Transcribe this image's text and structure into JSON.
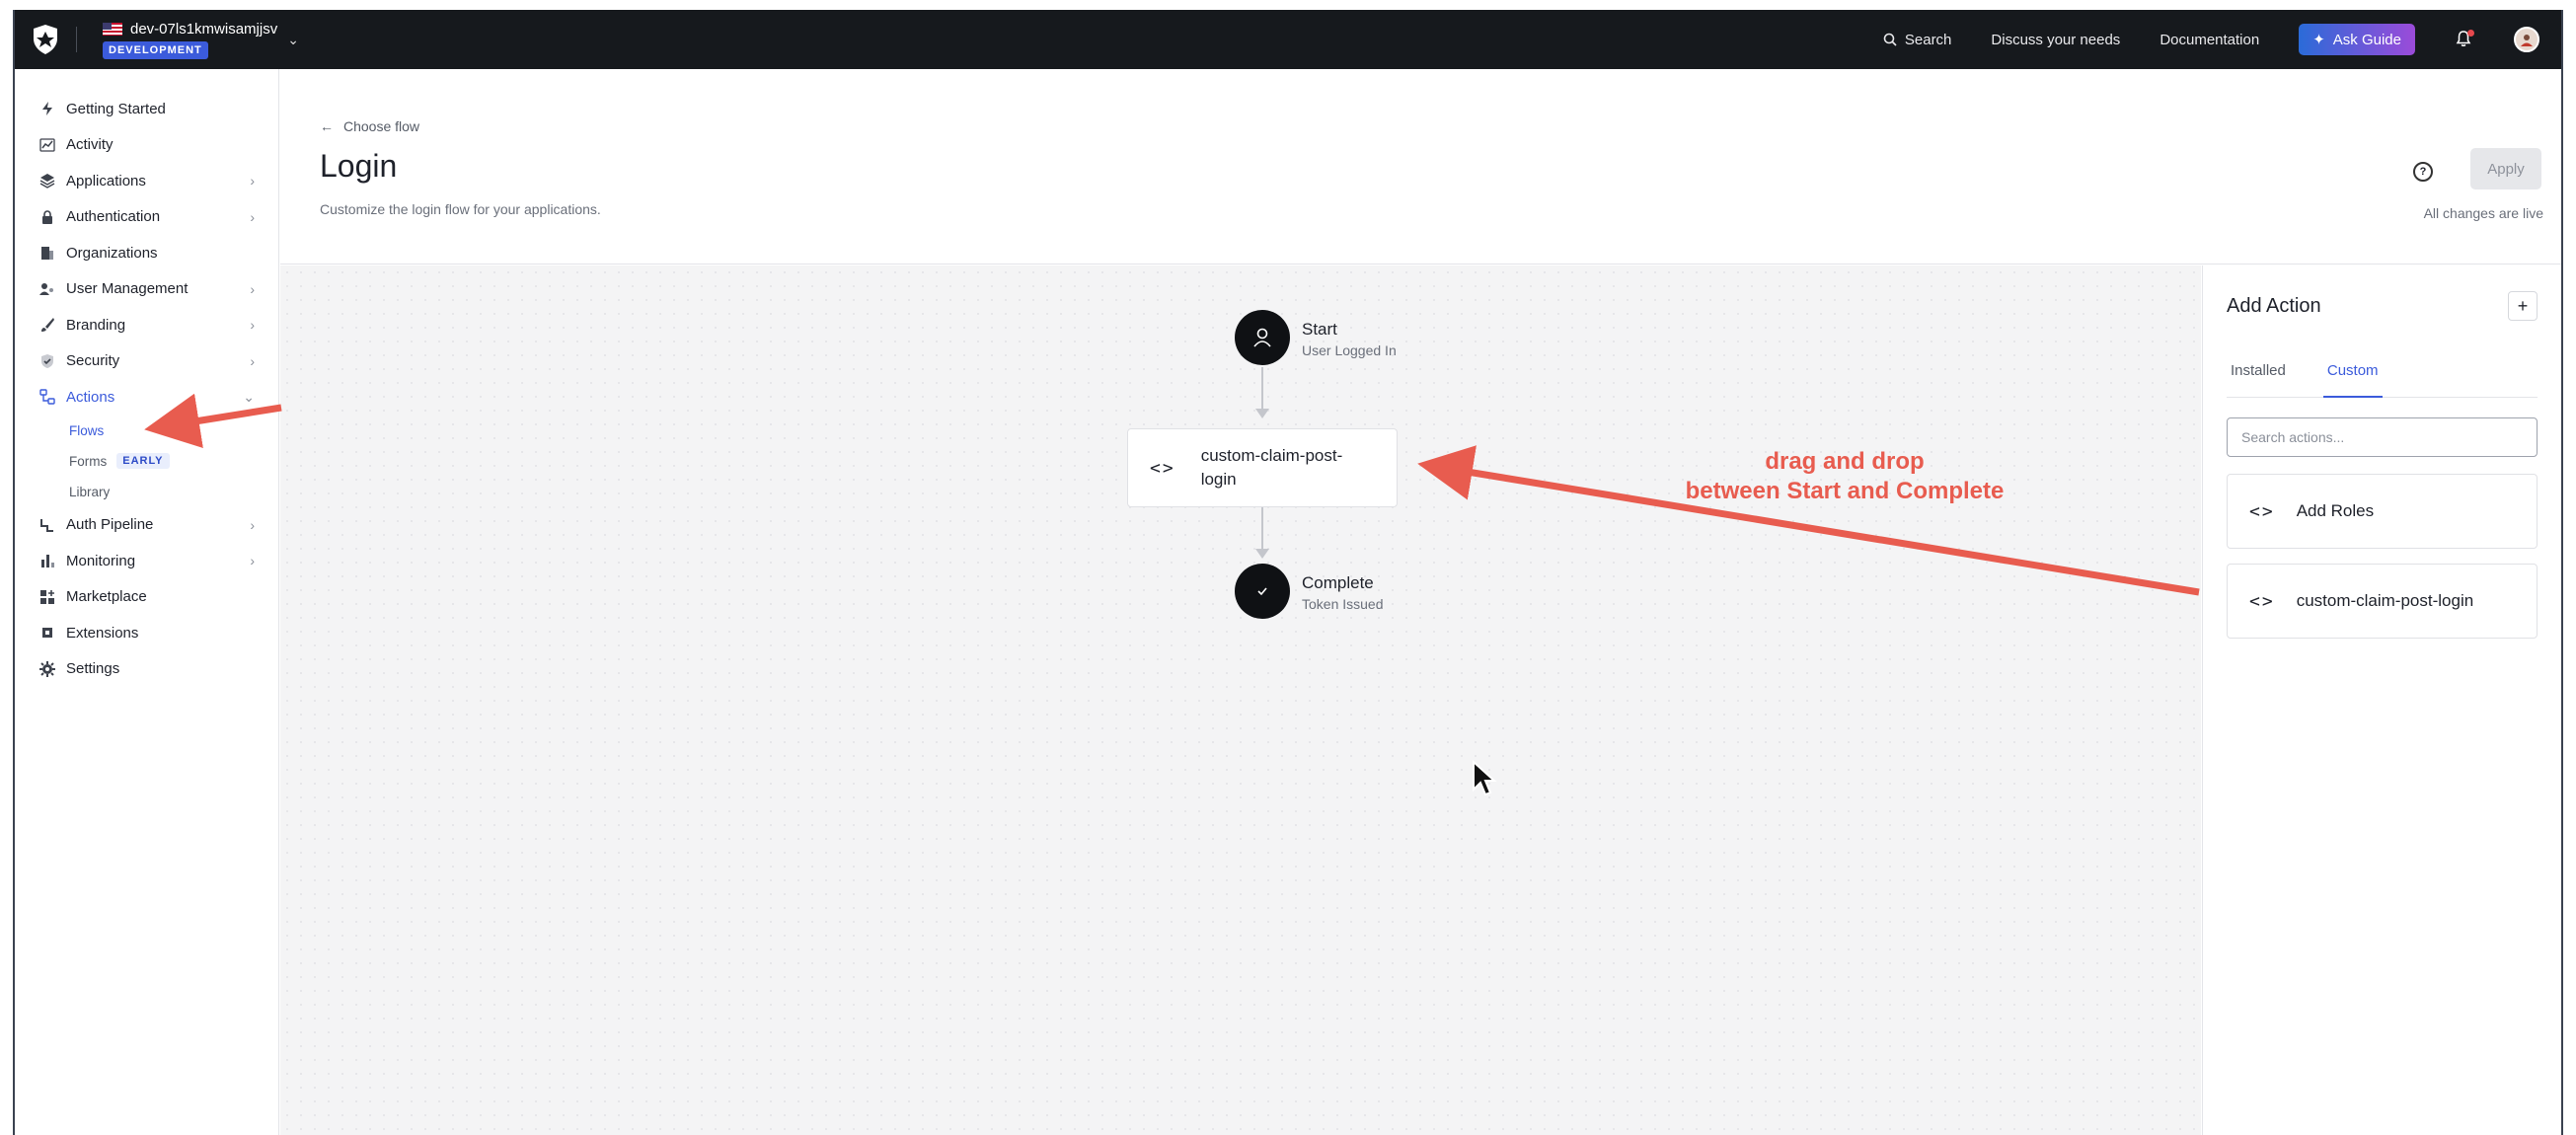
{
  "topbar": {
    "tenant_name": "dev-07ls1kmwisamjjsv",
    "env_badge": "DEVELOPMENT",
    "search_label": "Search",
    "discuss_label": "Discuss your needs",
    "docs_label": "Documentation",
    "ask_guide_label": "Ask Guide"
  },
  "sidebar": {
    "items": [
      {
        "label": "Getting Started",
        "icon": "bolt-icon"
      },
      {
        "label": "Activity",
        "icon": "chart-line-icon"
      },
      {
        "label": "Applications",
        "icon": "layers-icon"
      },
      {
        "label": "Authentication",
        "icon": "lock-icon"
      },
      {
        "label": "Organizations",
        "icon": "building-icon"
      },
      {
        "label": "User Management",
        "icon": "users-icon"
      },
      {
        "label": "Branding",
        "icon": "brush-icon"
      },
      {
        "label": "Security",
        "icon": "shield-check-icon"
      },
      {
        "label": "Actions",
        "icon": "flow-icon"
      },
      {
        "label": "Auth Pipeline",
        "icon": "pipeline-icon"
      },
      {
        "label": "Monitoring",
        "icon": "bar-chart-icon"
      },
      {
        "label": "Marketplace",
        "icon": "grid-plus-icon"
      },
      {
        "label": "Extensions",
        "icon": "chip-icon"
      },
      {
        "label": "Settings",
        "icon": "gear-icon"
      }
    ],
    "actions_sub": {
      "flows": "Flows",
      "forms": "Forms",
      "forms_badge": "EARLY",
      "library": "Library"
    }
  },
  "header": {
    "back_label": "Choose flow",
    "title": "Login",
    "subtitle": "Customize the login flow for your applications.",
    "apply_label": "Apply",
    "live_status": "All changes are live"
  },
  "canvas": {
    "start": {
      "title": "Start",
      "sub": "User Logged In"
    },
    "action": {
      "label": "custom-claim-post-login"
    },
    "complete": {
      "title": "Complete",
      "sub": "Token Issued"
    },
    "annotation_line1": "drag and drop",
    "annotation_line2": "between Start and Complete"
  },
  "panel": {
    "title": "Add Action",
    "tabs": [
      "Installed",
      "Custom"
    ],
    "active_tab": "Custom",
    "search_placeholder": "Search actions...",
    "actions": [
      "Add Roles",
      "custom-claim-post-login"
    ]
  },
  "colors": {
    "accent": "#3b5bdb",
    "topbar": "#16191d",
    "annotation": "#e85c4f"
  }
}
